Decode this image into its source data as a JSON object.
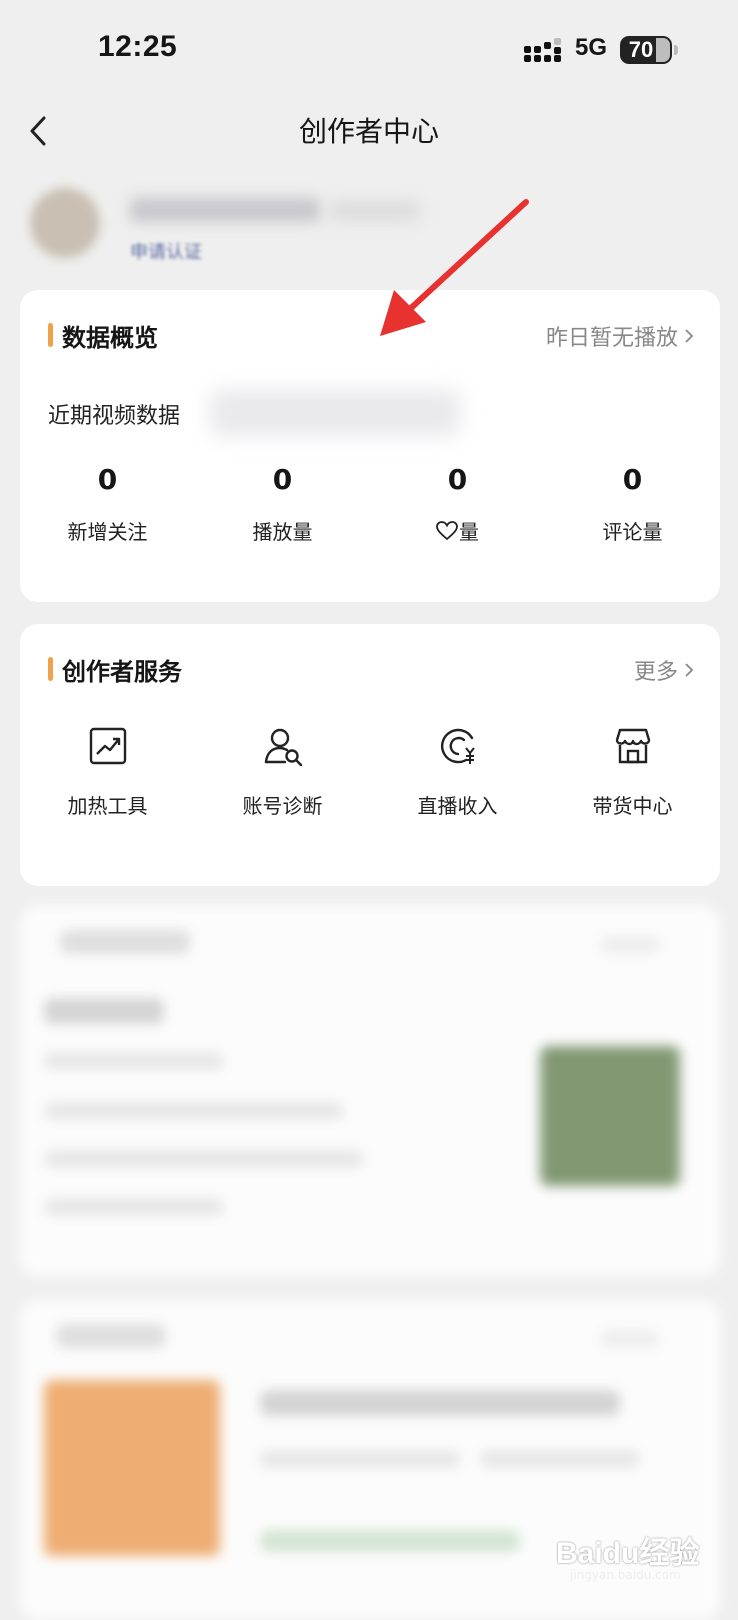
{
  "status_bar": {
    "time": "12:25",
    "network": "5G",
    "battery": "70"
  },
  "nav": {
    "title": "创作者中心"
  },
  "profile": {
    "subtitle": "申请认证"
  },
  "data_overview": {
    "title": "数据概览",
    "link": "昨日暂无播放",
    "recent_label": "近期视频数据",
    "stats": [
      {
        "value": "0",
        "label": "新增关注"
      },
      {
        "value": "0",
        "label": "播放量"
      },
      {
        "value": "0",
        "label": "量",
        "icon": "heart-icon"
      },
      {
        "value": "0",
        "label": "评论量"
      }
    ]
  },
  "creator_services": {
    "title": "创作者服务",
    "link": "更多",
    "items": [
      {
        "label": "加热工具",
        "icon": "trend-chart-icon"
      },
      {
        "label": "账号诊断",
        "icon": "user-search-icon"
      },
      {
        "label": "直播收入",
        "icon": "live-income-icon"
      },
      {
        "label": "带货中心",
        "icon": "store-icon"
      }
    ]
  },
  "colors": {
    "accent": "#f0a24a",
    "annotation_arrow": "#e8322f",
    "background": "#efefef"
  },
  "watermark": {
    "text": "Baidu经验",
    "sub": "jingyan.baidu.com"
  }
}
